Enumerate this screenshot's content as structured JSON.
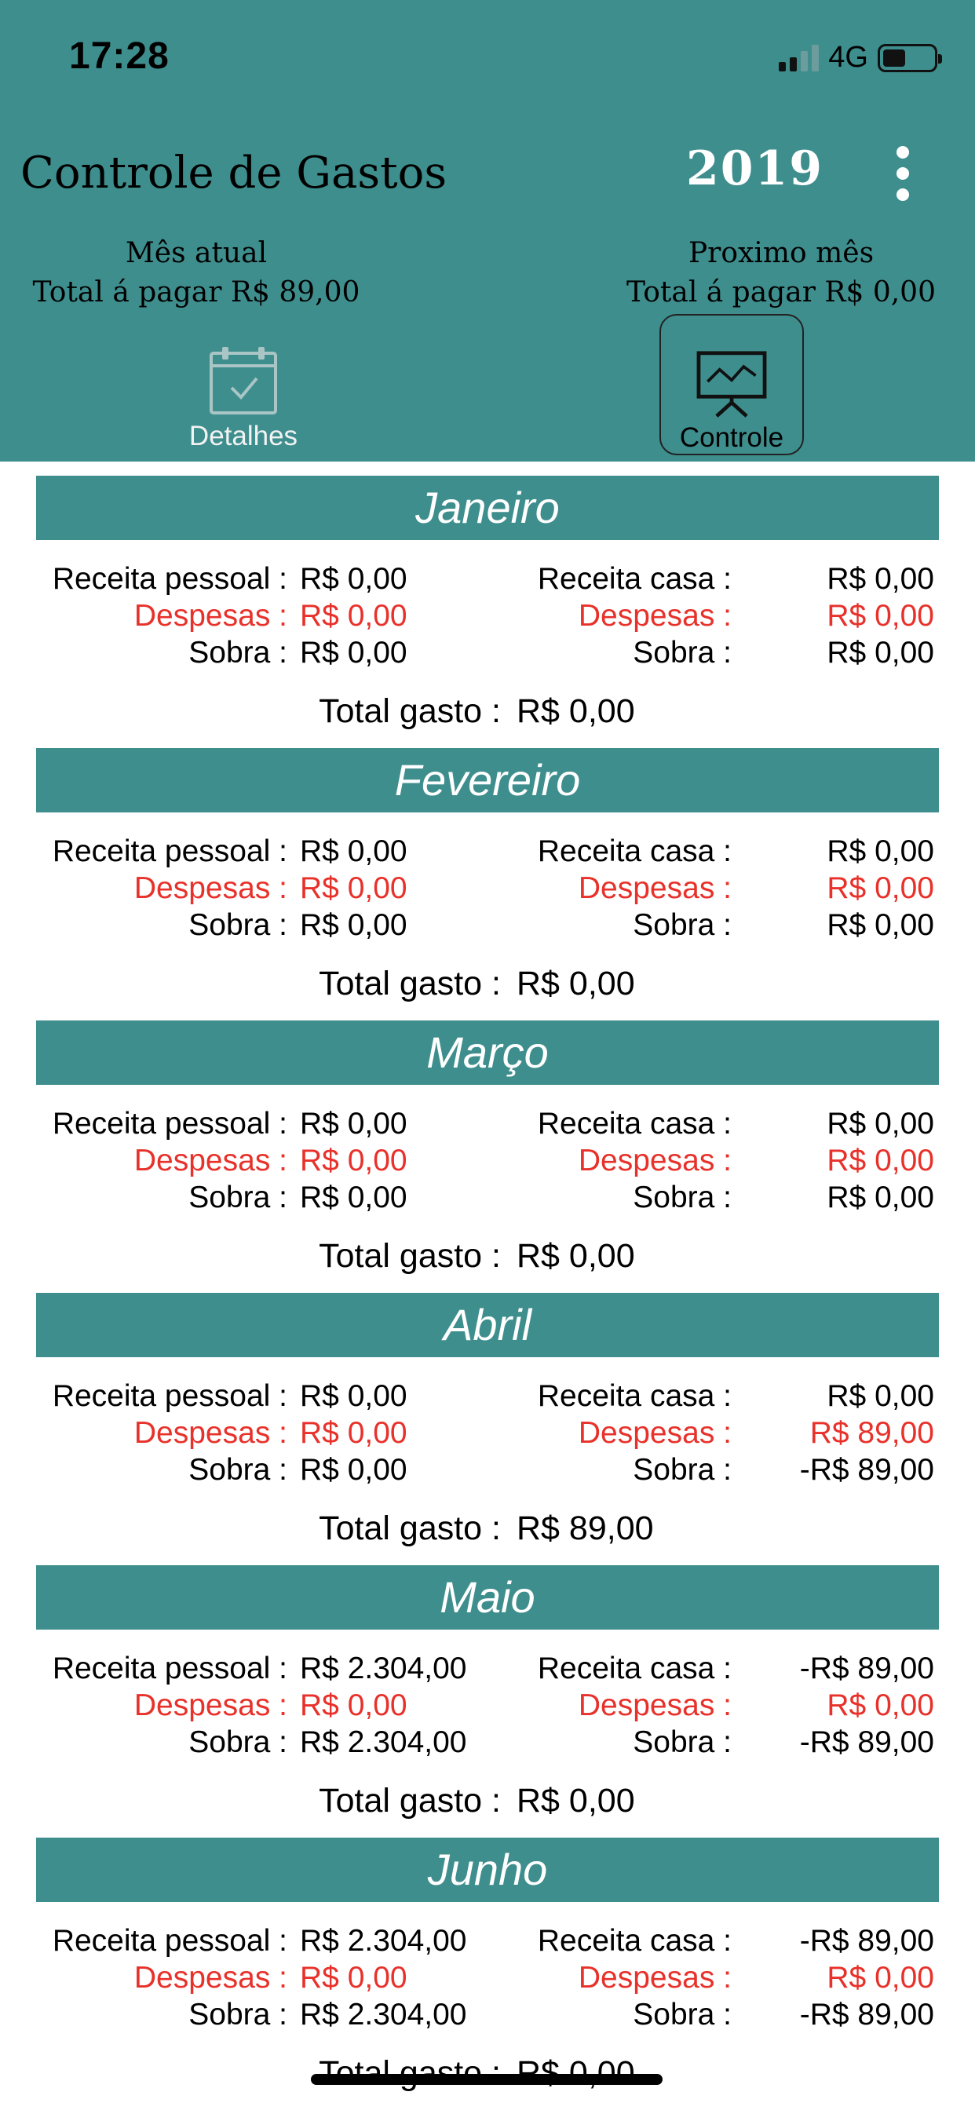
{
  "status_bar": {
    "time": "17:28",
    "network": "4G"
  },
  "app": {
    "title": "Controle de Gastos",
    "year": "2019",
    "menu_icon": "more-vertical-icon"
  },
  "summary": {
    "current": {
      "label": "Mês atual",
      "total_label": "Total á pagar",
      "total_value": "R$ 89,00"
    },
    "next": {
      "label": "Proximo mês",
      "total_label": "Total á pagar",
      "total_value": "R$ 0,00"
    }
  },
  "nav": {
    "details": {
      "label": "Detalhes",
      "icon": "calendar-check-icon"
    },
    "control": {
      "label": "Controle",
      "icon": "presentation-chart-icon"
    }
  },
  "labels": {
    "receita_pessoal": "Receita pessoal :",
    "receita_casa": "Receita casa :",
    "despesas": "Despesas :",
    "sobra": "Sobra :",
    "total_gasto": "Total gasto :"
  },
  "colors": {
    "primary": "#3f8e8e",
    "expense": "#e8312a",
    "text": "#000000"
  },
  "months": [
    {
      "name": "Janeiro",
      "pessoal": {
        "receita": "R$ 0,00",
        "despesas": "R$ 0,00",
        "sobra": "R$ 0,00"
      },
      "casa": {
        "receita": "R$ 0,00",
        "despesas": "R$ 0,00",
        "sobra": "R$ 0,00"
      },
      "total_gasto": "R$ 0,00"
    },
    {
      "name": "Fevereiro",
      "pessoal": {
        "receita": "R$ 0,00",
        "despesas": "R$ 0,00",
        "sobra": "R$ 0,00"
      },
      "casa": {
        "receita": "R$ 0,00",
        "despesas": "R$ 0,00",
        "sobra": "R$ 0,00"
      },
      "total_gasto": "R$ 0,00"
    },
    {
      "name": "Março",
      "pessoal": {
        "receita": "R$ 0,00",
        "despesas": "R$ 0,00",
        "sobra": "R$ 0,00"
      },
      "casa": {
        "receita": "R$ 0,00",
        "despesas": "R$ 0,00",
        "sobra": "R$ 0,00"
      },
      "total_gasto": "R$ 0,00"
    },
    {
      "name": "Abril",
      "pessoal": {
        "receita": "R$ 0,00",
        "despesas": "R$ 0,00",
        "sobra": "R$ 0,00"
      },
      "casa": {
        "receita": "R$ 0,00",
        "despesas": "R$ 89,00",
        "sobra": "-R$ 89,00"
      },
      "total_gasto": "R$ 89,00"
    },
    {
      "name": "Maio",
      "pessoal": {
        "receita": "R$ 2.304,00",
        "despesas": "R$ 0,00",
        "sobra": "R$ 2.304,00"
      },
      "casa": {
        "receita": "-R$ 89,00",
        "despesas": "R$ 0,00",
        "sobra": "-R$ 89,00"
      },
      "total_gasto": "R$ 0,00"
    },
    {
      "name": "Junho",
      "pessoal": {
        "receita": "R$ 2.304,00",
        "despesas": "R$ 0,00",
        "sobra": "R$ 2.304,00"
      },
      "casa": {
        "receita": "-R$ 89,00",
        "despesas": "R$ 0,00",
        "sobra": "-R$ 89,00"
      },
      "total_gasto": "R$ 0,00"
    }
  ]
}
